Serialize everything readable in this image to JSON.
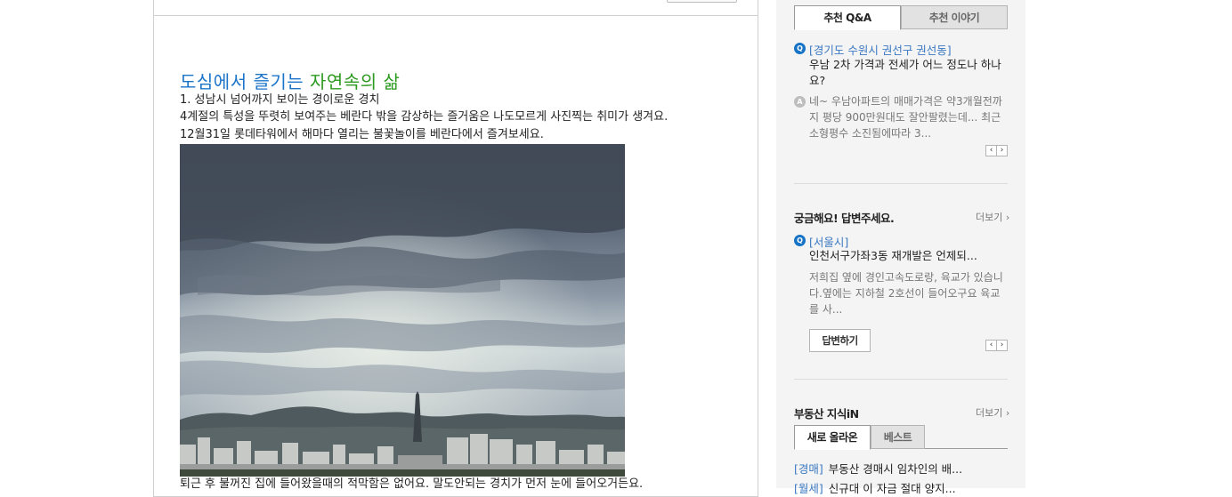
{
  "article": {
    "title_part1": "도심에서 즐기는 ",
    "title_part2": "자연속의 삶",
    "lines": [
      "1. 성남시 넘어까지 보이는 경이로운 경치",
      "4계절의 특성을 뚜렷히 보여주는 베란다 밖을 감상하는 즐거움은 나도모르게 사진찍는 취미가 생겨요.",
      "12월31일 롯데타워에서 해마다 열리는 불꽃놀이를 베란다에서 즐겨보세요.",
      "퇴근 후 불꺼진 집에 들어왔을때의 적막함은 없어요. 말도안되는 경치가 먼저 눈에 들어오거든요."
    ]
  },
  "sidebar": {
    "tabs": [
      "추천 Q&A",
      "추천 이야기"
    ],
    "featured_qa": {
      "q_badge": "Q",
      "a_badge": "A",
      "location": "[경기도 수원시 권선구 권선동]",
      "question": "우남 2차 가격과 전세가 어느 정도나 하나요?",
      "answer": "네~ 우남아파트의 매매가격은 약3개월전까지 평당 900만원대도 잘안팔렸는데... 최근 소형평수 소진됨에따라 3..."
    },
    "curious": {
      "title": "궁금해요! 답변주세요.",
      "more": "더보기 ›",
      "q_badge": "Q",
      "location": "[서울시]",
      "question": "인천서구가좌3동 재개발은 언제되...",
      "answer": "저희집 옆에 경인고속도로랑, 육교가 있습니다.옆에는 지하철 2호선이 들어오구요 육교를 사...",
      "answer_button": "답변하기"
    },
    "knowledge": {
      "title": "부동산 지식iN",
      "more": "더보기 ›",
      "tabs": [
        "새로 올라온",
        "베스트"
      ],
      "items": [
        {
          "category": "[경매]",
          "text": "부동산 경매시 임차인의 배..."
        },
        {
          "category": "[월세]",
          "text": "신규대 이 자금 절대 양지..."
        }
      ]
    },
    "pager": {
      "prev": "‹",
      "next": "›"
    }
  }
}
